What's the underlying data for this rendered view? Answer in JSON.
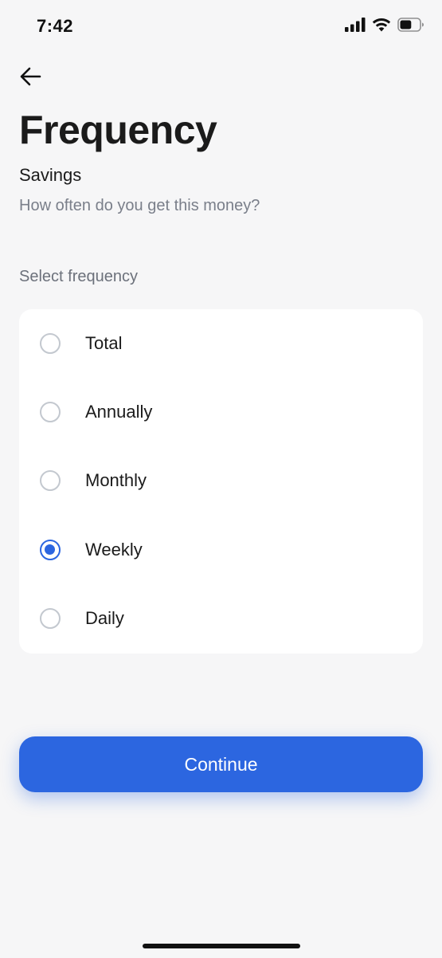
{
  "status_bar": {
    "time": "7:42",
    "icons": [
      "cellular-signal-icon",
      "wifi-icon",
      "battery-icon"
    ],
    "battery_level": 0.6
  },
  "header": {
    "back_icon": "arrow-left-icon",
    "title": "Frequency",
    "subtitle": "Savings",
    "question": "How often do you get this money?"
  },
  "form": {
    "section_label": "Select frequency",
    "options": [
      {
        "label": "Total",
        "selected": false
      },
      {
        "label": "Annually",
        "selected": false
      },
      {
        "label": "Monthly",
        "selected": false
      },
      {
        "label": "Weekly",
        "selected": true
      },
      {
        "label": "Daily",
        "selected": false
      }
    ],
    "continue_label": "Continue"
  },
  "colors": {
    "accent": "#2c66e0",
    "background": "#f6f6f7",
    "card": "#ffffff",
    "muted_text": "#7a7f8a"
  }
}
